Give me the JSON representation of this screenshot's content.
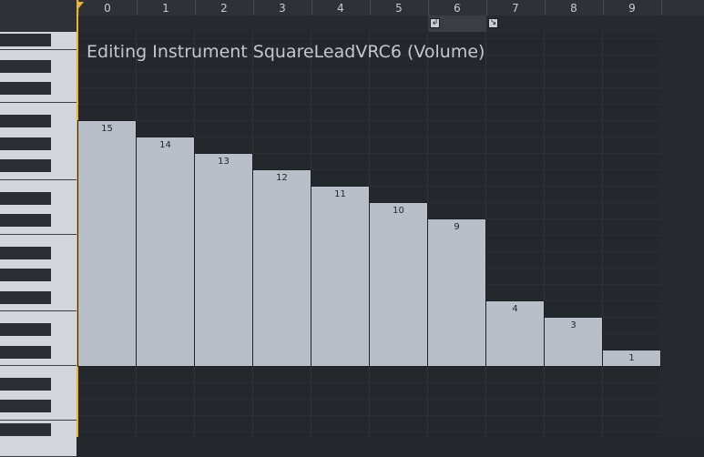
{
  "editor": {
    "title": "Editing Instrument SquareLeadVRC6 (Volume)",
    "envelope": "Volume"
  },
  "ruler": {
    "columns": [
      "0",
      "1",
      "2",
      "3",
      "4",
      "5",
      "6",
      "7",
      "8",
      "9"
    ]
  },
  "loop": {
    "start_icon": "loop-start-icon",
    "end_icon": "release-icon",
    "loop_start_column": 6,
    "release_column": 7
  },
  "chart_data": {
    "type": "bar",
    "categories": [
      "0",
      "1",
      "2",
      "3",
      "4",
      "5",
      "6",
      "7",
      "8",
      "9"
    ],
    "values": [
      15,
      14,
      13,
      12,
      11,
      10,
      9,
      4,
      3,
      1
    ],
    "ylim": [
      0,
      15
    ]
  },
  "colors": {
    "accent": "#e8b43a",
    "bar": "#b9bfc8",
    "background": "#24272b"
  }
}
